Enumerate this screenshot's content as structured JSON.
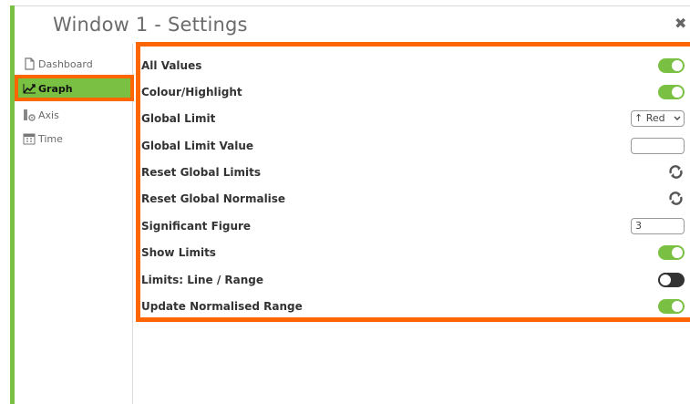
{
  "window": {
    "title": "Window 1 - Settings",
    "close_icon": "close-icon"
  },
  "sidebar": {
    "items": [
      {
        "label": "Dashboard",
        "icon": "document-icon"
      },
      {
        "label": "Graph",
        "icon": "trend-line-icon",
        "active": true
      },
      {
        "label": "Axis",
        "icon": "axis-icon"
      },
      {
        "label": "Time",
        "icon": "calendar-icon"
      }
    ]
  },
  "settings": [
    {
      "label": "All Values",
      "control": "toggle",
      "value": "on"
    },
    {
      "label": "Colour/Highlight",
      "control": "toggle",
      "value": "on"
    },
    {
      "label": "Global Limit",
      "control": "select",
      "value": "↑ Red"
    },
    {
      "label": "Global Limit Value",
      "control": "input",
      "value": ""
    },
    {
      "label": "Reset Global Limits",
      "control": "refresh",
      "icon": "refresh-icon"
    },
    {
      "label": "Reset Global Normalise",
      "control": "refresh",
      "icon": "refresh-icon"
    },
    {
      "label": "Significant Figure",
      "control": "input",
      "value": "3"
    },
    {
      "label": "Show Limits",
      "control": "toggle",
      "value": "on"
    },
    {
      "label": "Limits: Line / Range",
      "control": "toggle",
      "value": "off"
    },
    {
      "label": "Update Normalised Range",
      "control": "toggle",
      "value": "on"
    }
  ],
  "colors": {
    "accent_green": "#7ac143",
    "highlight_orange": "#ff6600",
    "toggle_off": "#333333"
  }
}
